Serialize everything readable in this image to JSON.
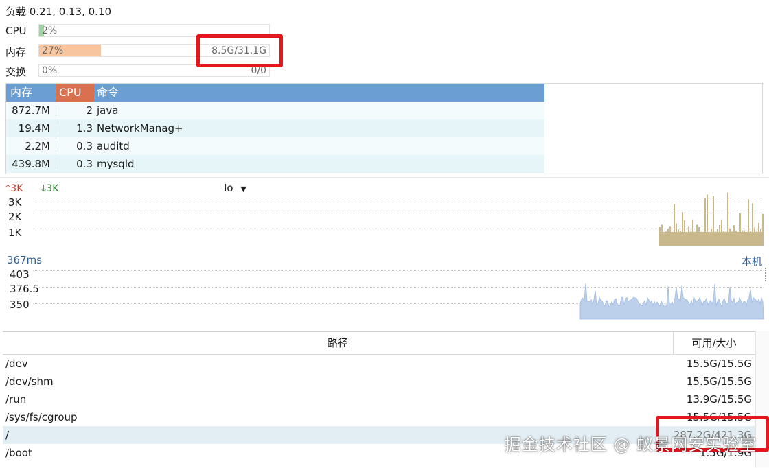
{
  "load": {
    "label": "负载 0.21, 0.13, 0.10"
  },
  "stats": {
    "cpu": {
      "label": "CPU",
      "percent_text": "2%",
      "fraction": 0.02
    },
    "memory": {
      "label": "内存",
      "percent_text": "27%",
      "fraction": 0.27,
      "usage": "8.5G/31.1G"
    },
    "swap": {
      "label": "交换",
      "percent_text": "0%",
      "fraction": 0.0,
      "usage": "0/0"
    }
  },
  "process_table": {
    "headers": {
      "mem": "内存",
      "cpu": "CPU",
      "command": "命令"
    },
    "rows": [
      {
        "mem": "872.7M",
        "cpu": "2",
        "command": "java"
      },
      {
        "mem": "19.4M",
        "cpu": "1.3",
        "command": "NetworkManag+"
      },
      {
        "mem": "2.2M",
        "cpu": "0.3",
        "command": "auditd"
      },
      {
        "mem": "439.8M",
        "cpu": "0.3",
        "command": "mysqld"
      }
    ]
  },
  "network": {
    "up": "3K",
    "down": "3K",
    "io_select": "Io",
    "yticks": [
      "3K",
      "2K",
      "1K"
    ]
  },
  "latency": {
    "value": "367ms",
    "target": "本机",
    "yticks": [
      "403",
      "376.5",
      "350"
    ]
  },
  "disk_table": {
    "headers": {
      "path": "路径",
      "size": "可用/大小"
    },
    "rows": [
      {
        "path": "/dev",
        "size": "15.5G/15.5G"
      },
      {
        "path": "/dev/shm",
        "size": "15.5G/15.5G"
      },
      {
        "path": "/run",
        "size": "13.9G/15.5G"
      },
      {
        "path": "/sys/fs/cgroup",
        "size": "15.5G/15.5G"
      },
      {
        "path": "/",
        "size": "287.2G/421.3G"
      },
      {
        "path": "/boot",
        "size": "1.5G/1.9G"
      }
    ]
  },
  "watermark": "掘金技术社区 @ 蚁景网安实验室",
  "colors": {
    "header_blue": "#6b9fd4",
    "header_cpu": "#d9704f",
    "memory_fill": "#f7c6a0",
    "cpu_fill": "#9fd49f",
    "net_bars": "#c9b88c",
    "latency_fill": "#bcd0ec",
    "up_arrow": "#c0392b",
    "down_arrow": "#2e7d32",
    "highlight_box": "#e5161d"
  }
}
